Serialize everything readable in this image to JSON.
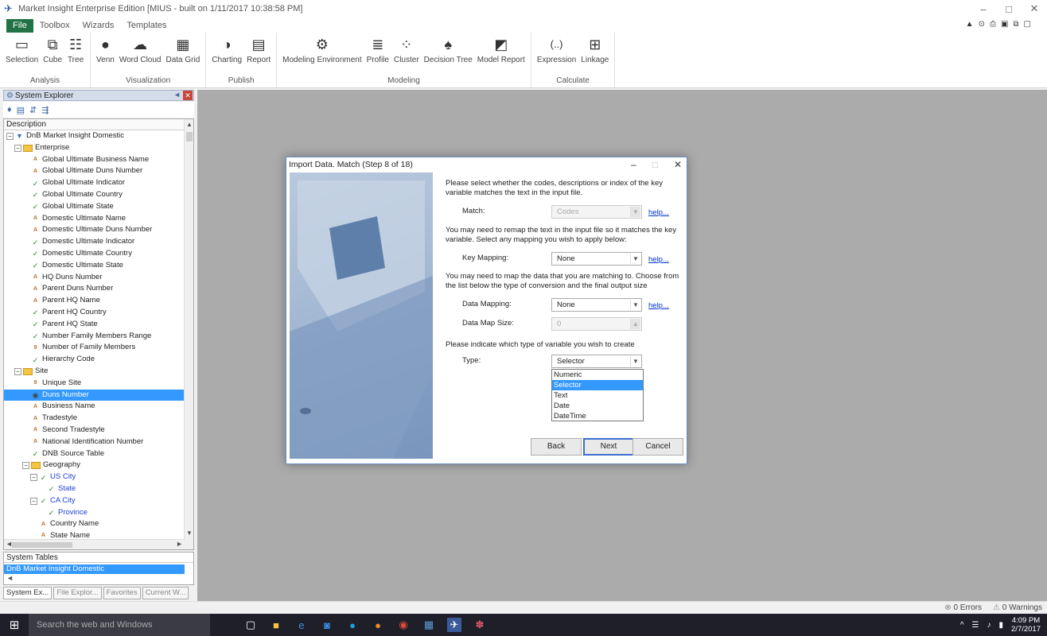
{
  "window": {
    "title": "Market Insight Enterprise Edition [MIUS - built on 1/11/2017 10:38:58 PM]",
    "controls": [
      "–",
      "□",
      "✕"
    ]
  },
  "ribbon_tabs": [
    "File",
    "Toolbox",
    "Wizards",
    "Templates"
  ],
  "ribbon_groups": [
    {
      "label": "Analysis",
      "buttons": [
        {
          "label": "Selection",
          "icon": "selection-icon"
        },
        {
          "label": "Cube",
          "icon": "cube-icon"
        },
        {
          "label": "Tree",
          "icon": "tree-icon"
        }
      ]
    },
    {
      "label": "Visualization",
      "buttons": [
        {
          "label": "Venn",
          "icon": "venn-icon"
        },
        {
          "label": "Word Cloud",
          "icon": "cloud-icon"
        },
        {
          "label": "Data Grid",
          "icon": "grid-icon"
        }
      ]
    },
    {
      "label": "Publish",
      "buttons": [
        {
          "label": "Charting",
          "icon": "chart-icon"
        },
        {
          "label": "Report",
          "icon": "report-icon"
        }
      ]
    },
    {
      "label": "Modeling",
      "buttons": [
        {
          "label": "Modeling Environment",
          "icon": "modeling-icon"
        },
        {
          "label": "Profile",
          "icon": "profile-icon"
        },
        {
          "label": "Cluster",
          "icon": "cluster-icon"
        },
        {
          "label": "Decision Tree",
          "icon": "decision-tree-icon"
        },
        {
          "label": "Model Report",
          "icon": "model-report-icon"
        }
      ]
    },
    {
      "label": "Calculate",
      "buttons": [
        {
          "label": "Expression",
          "icon": "expression-icon"
        },
        {
          "label": "Linkage",
          "icon": "linkage-icon"
        }
      ]
    }
  ],
  "explorer": {
    "title": "System Explorer",
    "column_header": "Description",
    "tree": [
      {
        "label": "DnB Market Insight Domestic",
        "icon": "database-icon",
        "indent": 0,
        "expander": "⊟"
      },
      {
        "label": "Enterprise",
        "icon": "folder-icon",
        "indent": 1,
        "expander": "⊟"
      },
      {
        "label": "Global Ultimate Business Name",
        "icon": "abc-icon",
        "indent": 2
      },
      {
        "label": "Global Ultimate Duns Number",
        "icon": "abc-icon",
        "indent": 2
      },
      {
        "label": "Global Ultimate Indicator",
        "icon": "check-icon",
        "indent": 2
      },
      {
        "label": "Global Ultimate Country",
        "icon": "check-icon",
        "indent": 2
      },
      {
        "label": "Global Ultimate State",
        "icon": "check-icon",
        "indent": 2
      },
      {
        "label": "Domestic Ultimate Name",
        "icon": "abc-icon",
        "indent": 2
      },
      {
        "label": "Domestic Ultimate Duns Number",
        "icon": "abc-icon",
        "indent": 2
      },
      {
        "label": "Domestic Ultimate Indicator",
        "icon": "check-icon",
        "indent": 2
      },
      {
        "label": "Domestic Ultimate Country",
        "icon": "check-icon",
        "indent": 2
      },
      {
        "label": "Domestic Ultimate State",
        "icon": "check-icon",
        "indent": 2
      },
      {
        "label": "HQ Duns Number",
        "icon": "abc-icon",
        "indent": 2
      },
      {
        "label": "Parent Duns Number",
        "icon": "abc-icon",
        "indent": 2
      },
      {
        "label": "Parent HQ Name",
        "icon": "abc-icon",
        "indent": 2
      },
      {
        "label": "Parent HQ Country",
        "icon": "check-icon",
        "indent": 2
      },
      {
        "label": "Parent HQ State",
        "icon": "check-icon",
        "indent": 2
      },
      {
        "label": "Number Family Members Range",
        "icon": "check-icon",
        "indent": 2
      },
      {
        "label": "Number of Family Members",
        "icon": "number-icon",
        "indent": 2
      },
      {
        "label": "Hierarchy Code",
        "icon": "check-icon",
        "indent": 2
      },
      {
        "label": "Site",
        "icon": "folder-icon",
        "indent": 1,
        "expander": "⊟"
      },
      {
        "label": "Unique Site",
        "icon": "number-icon",
        "indent": 2
      },
      {
        "label": "Duns Number",
        "icon": "id-icon",
        "indent": 2,
        "selected": true
      },
      {
        "label": "Business Name",
        "icon": "abc-icon",
        "indent": 2
      },
      {
        "label": "Tradestyle",
        "icon": "abc-icon",
        "indent": 2
      },
      {
        "label": "Second Tradestyle",
        "icon": "abc-icon",
        "indent": 2
      },
      {
        "label": "National Identification Number",
        "icon": "abc-icon",
        "indent": 2
      },
      {
        "label": "DNB Source Table",
        "icon": "check-icon",
        "indent": 2
      },
      {
        "label": "Geography",
        "icon": "folder-icon",
        "indent": 2,
        "expander": "⊟"
      },
      {
        "label": "US City",
        "icon": "check-icon",
        "indent": 3,
        "expander": "⊟",
        "blue": true
      },
      {
        "label": "State",
        "icon": "check-icon",
        "indent": 4,
        "blue": true
      },
      {
        "label": "CA City",
        "icon": "check-icon",
        "indent": 3,
        "expander": "⊟",
        "blue": true
      },
      {
        "label": "Province",
        "icon": "check-icon",
        "indent": 4,
        "blue": true
      },
      {
        "label": "Country Name",
        "icon": "abc-icon",
        "indent": 3
      },
      {
        "label": "State Name",
        "icon": "abc-icon",
        "indent": 3
      }
    ]
  },
  "system_tables": {
    "title": "System Tables",
    "row": "DnB Market Insight Domestic"
  },
  "panel_tabs": [
    "System Ex...",
    "File Explor...",
    "Favorites",
    "Current W..."
  ],
  "status": {
    "errors": "0 Errors",
    "warnings": "0 Warnings"
  },
  "taskbar": {
    "search_placeholder": "Search the web and Windows",
    "time": "4:09 PM",
    "date": "2/7/2017"
  },
  "dialog": {
    "title": "Import Data.  Match (Step 8 of 18)",
    "intro_text": "Please select whether the codes, descriptions or index of the key variable matches the text in the input file.",
    "match_label": "Match:",
    "match_value": "Codes",
    "remap_text": "You may need to remap the text in the input file so it matches the key variable. Select any mapping you wish to apply below:",
    "key_mapping_label": "Key Mapping:",
    "key_mapping_value": "None",
    "map_data_text": "You may need to map the data that you are matching to.  Choose from the list below the type of conversion and the final output size",
    "data_mapping_label": "Data Mapping:",
    "data_mapping_value": "None",
    "data_map_size_label": "Data Map Size:",
    "data_map_size_value": "0",
    "variable_type_text": "Please indicate which type of variable you wish to create",
    "type_label": "Type:",
    "type_value": "Selector",
    "type_options": [
      "Numeric",
      "Selector",
      "Text",
      "Date",
      "DateTime"
    ],
    "type_selected_option": "Selector",
    "help_link": "help...",
    "back_label": "Back",
    "next_label": "Next",
    "cancel_label": "Cancel"
  }
}
